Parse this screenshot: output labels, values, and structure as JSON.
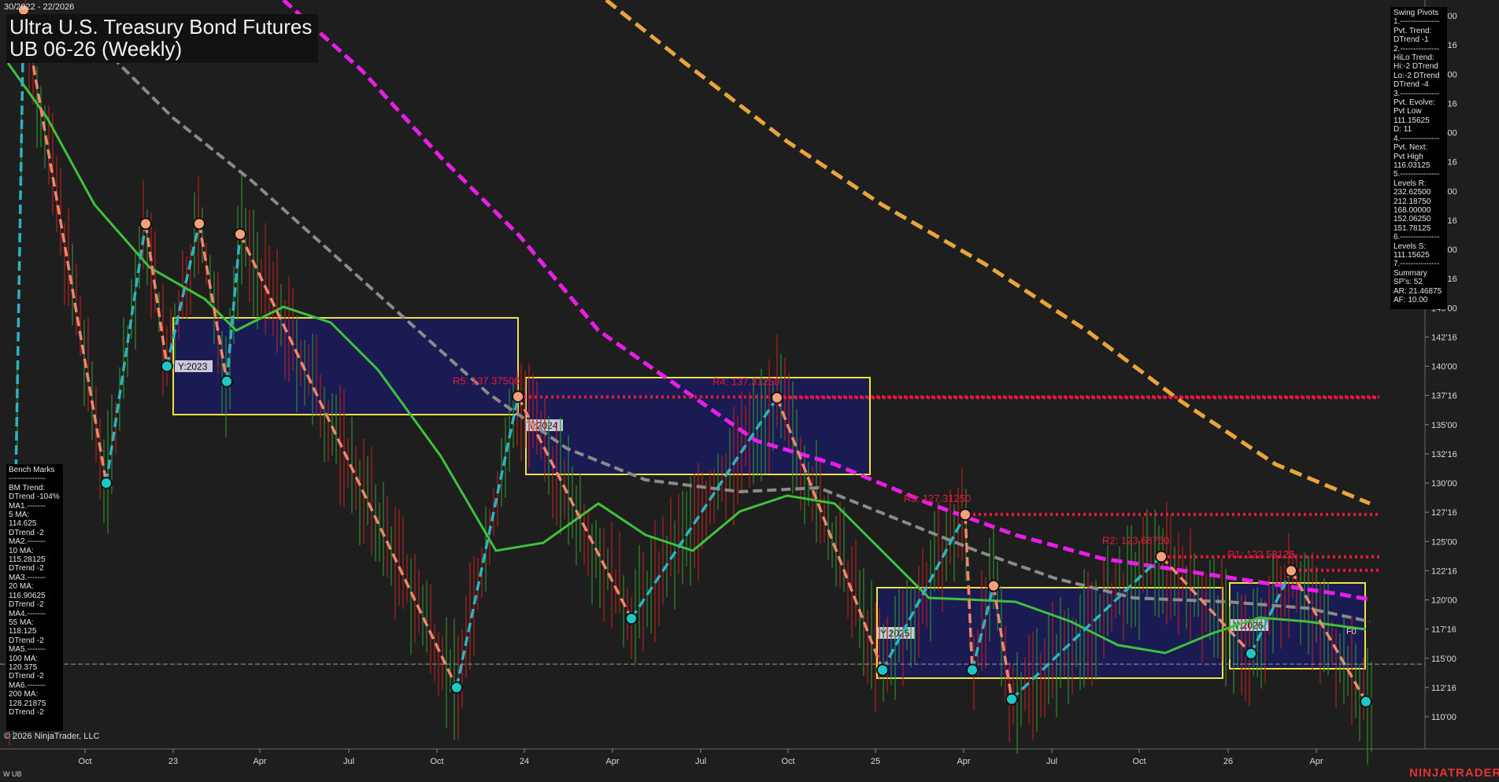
{
  "header": {
    "range": "30/2022 - 22/2026",
    "title_line1": "Ultra U.S. Treasury Bond Futures",
    "title_line2": "UB 06-26 (Weekly)"
  },
  "footer": {
    "copyright": "© 2026 NinjaTrader, LLC",
    "symbol": "W UB",
    "brand": "NINJATRADER"
  },
  "swing_panel": {
    "lines": [
      "Swing Pivots",
      "1.---------------",
      "Pvt. Trend:",
      "DTrend -1",
      "2.---------------",
      "HiLo Trend:",
      "Hi:-2 DTrend",
      "Lo:-2 DTrend",
      "DTrend -4",
      "3.---------------",
      "Pvt. Evolve:",
      "Pvt Low",
      "111.15625",
      "D: 11",
      "4.---------------",
      "Pvt. Next:",
      "Pvt High",
      "116.03125",
      "5.---------------",
      "Levels R:",
      "232.62500",
      "212.18750",
      "168.00000",
      "152.06250",
      "151.78125",
      "6.---------------",
      "Levels S:",
      "111.15625",
      "7.---------------",
      "Summary",
      "SP's: 52",
      "AR: 21.46875",
      "AF: 10.00"
    ]
  },
  "bench_panel": {
    "lines": [
      "Bench Marks",
      "--------------",
      "BM Trend:",
      "DTrend -104%",
      "MA1.-------",
      "5 MA:",
      "114.625",
      "DTrend -2",
      "MA2.-------",
      "10 MA:",
      "115.28125",
      "DTrend -2",
      "MA3.-------",
      "20 MA:",
      "116.90625",
      "DTrend -2",
      "MA4.-------",
      "55 MA:",
      "118.125",
      "DTrend -2",
      "MA5.-------",
      "100 MA:",
      "120.375",
      "DTrend -2",
      "MA6.-------",
      "200 MA:",
      "128.21875",
      "DTrend -2"
    ]
  },
  "chart_data": {
    "type": "line",
    "title": "Ultra U.S. Treasury Bond Futures UB 06-26 (Weekly)",
    "y_axis": {
      "ticks": [
        "170'00",
        "167'16",
        "165'00",
        "162'16",
        "160'00",
        "157'16",
        "155'00",
        "152'16",
        "150'00",
        "147'16",
        "145'00",
        "142'16",
        "140'00",
        "137'16",
        "135'00",
        "132'16",
        "130'00",
        "127'16",
        "125'00",
        "122'16",
        "120'00",
        "117'16",
        "115'00",
        "112'16",
        "110'00"
      ],
      "ylim": [
        108.5,
        171.5
      ],
      "position": "right"
    },
    "x_axis": {
      "ticks": [
        "Oct",
        "23",
        "Apr",
        "Jul",
        "Oct",
        "24",
        "Apr",
        "Jul",
        "Oct",
        "25",
        "Apr",
        "Jul",
        "Oct",
        "26",
        "Apr"
      ]
    },
    "resistance_levels": [
      {
        "label": "R5: 137.37500",
        "value": 137.375
      },
      {
        "label": "R4: 137.31250",
        "value": 137.3125
      },
      {
        "label": "R3: 127.31250",
        "value": 127.3125
      },
      {
        "label": "R2: 123.68750",
        "value": 123.6875
      },
      {
        "label": "R1: 122.53125",
        "value": 122.53125
      }
    ],
    "year_boxes": [
      "Y:2023",
      "Y:2024",
      "Y:2025",
      "Y:2026"
    ],
    "fib_label": "F0",
    "current_price": 114.5,
    "swing_zigzag": [
      130.0,
      170.5,
      130.0,
      152.2,
      140.0,
      152.2,
      138.7,
      151.3,
      112.5,
      137.4,
      118.4,
      137.3,
      114.0,
      127.3,
      114.0,
      121.2,
      111.5,
      123.7,
      115.4,
      122.5,
      111.3
    ],
    "colors": {
      "background": "#1e1e1e",
      "up_swing": "#2bb3c0",
      "down_swing": "#f0876c",
      "ma_green": "#3ec23c",
      "ma_gray": "#8a8a8a",
      "ma_magenta": "#e81ee8",
      "ma_orange": "#e7a53a",
      "resistance": "#e8193c",
      "box_border": "#f2e33a",
      "box_fill": "#1b1b5e"
    }
  }
}
